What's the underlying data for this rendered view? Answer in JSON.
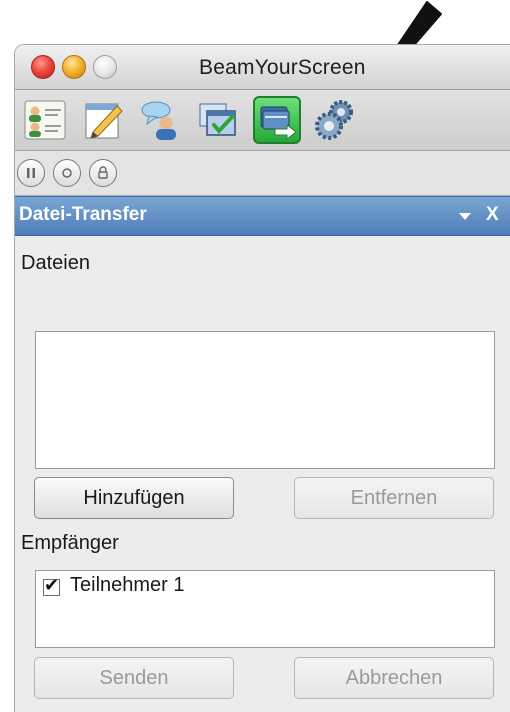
{
  "window": {
    "title": "BeamYourScreen"
  },
  "toolbar": {
    "buttons": [
      {
        "icon": "participants-list-icon"
      },
      {
        "icon": "notepad-pencil-icon"
      },
      {
        "icon": "chat-icon"
      },
      {
        "icon": "screen-approval-icon"
      },
      {
        "icon": "file-transfer-icon",
        "active": true
      },
      {
        "icon": "settings-gears-icon"
      }
    ]
  },
  "controls": {
    "buttons": [
      {
        "icon": "pause-icon"
      },
      {
        "icon": "record-icon"
      },
      {
        "icon": "lock-icon"
      }
    ]
  },
  "panel": {
    "title": "Datei-Transfer",
    "close_label": "X",
    "files_label": "Dateien",
    "add_button": "Hinzufügen",
    "remove_button": "Entfernen",
    "recipients_label": "Empfänger",
    "recipients": [
      {
        "name": "Teilnehmer 1",
        "checked": true,
        "mark": "✔"
      }
    ],
    "send_button": "Senden",
    "cancel_button": "Abbrechen"
  },
  "colors": {
    "panel_header": "#5a88c2",
    "active_button": "#3cbf4c",
    "close_light": "#f0473b",
    "minimize_light": "#f7b32c"
  }
}
